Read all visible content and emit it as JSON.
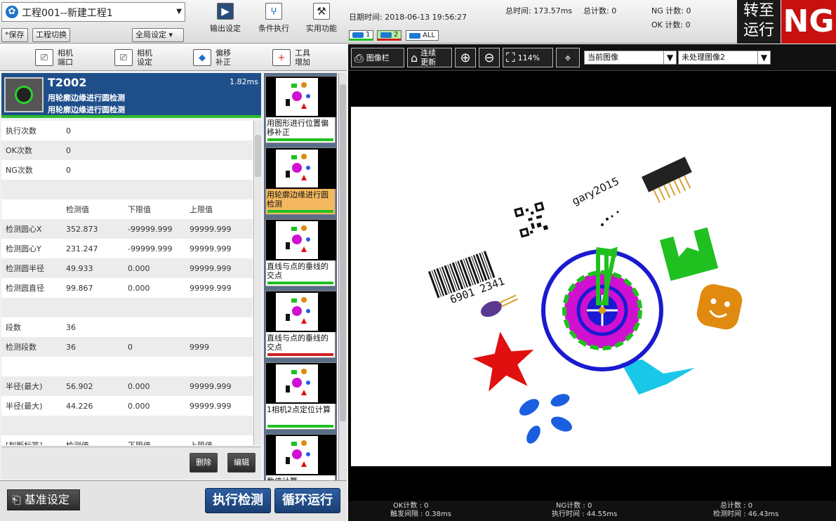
{
  "topbar": {
    "project_name": "工程001--新建工程1",
    "save_label": "*保存",
    "switch_project_label": "工程切换",
    "global_settings_label": "全局设定",
    "output_settings_label": "输出设定",
    "conditional_exec_label": "条件执行",
    "utility_label": "实用功能",
    "datetime": "日期时间: 2018-06-13 19:56:27",
    "total_time": "总时间: 173.57ms",
    "total_count": "总计数: 0",
    "ng_count": "NG 计数: 0",
    "ok_count": "OK 计数: 0",
    "run_switch_line1": "转至",
    "run_switch_line2": "运行",
    "result": "NG",
    "cam_chips": [
      "1",
      "2",
      "ALL"
    ]
  },
  "left_toolbar": [
    {
      "line1": "相机",
      "line2": "端口",
      "icon": "camera-port-icon"
    },
    {
      "line1": "相机",
      "line2": "设定",
      "icon": "camera-settings-icon"
    },
    {
      "line1": "偏移",
      "line2": "补正",
      "icon": "offset-correction-icon"
    },
    {
      "line1": "工具",
      "line2": "增加",
      "icon": "add-tool-icon"
    }
  ],
  "tool_header": {
    "id": "T2002",
    "time": "1.82ms",
    "name1": "用轮廓边缘进行圆检测",
    "name2": "用轮廓边缘进行圆检测"
  },
  "params": [
    [
      "执行次数",
      "0",
      "",
      ""
    ],
    [
      "OK次数",
      "0",
      "",
      ""
    ],
    [
      "NG次数",
      "0",
      "",
      ""
    ],
    [
      "",
      "",
      "",
      ""
    ],
    [
      "",
      "检测值",
      "下限值",
      "上限值"
    ],
    [
      "检测圆心X",
      "352.873",
      "-99999.999",
      "99999.999"
    ],
    [
      "检测圆心Y",
      "231.247",
      "-99999.999",
      "99999.999"
    ],
    [
      "检测圆半径",
      "49.933",
      "0.000",
      "99999.999"
    ],
    [
      "检测圆直径",
      "99.867",
      "0.000",
      "99999.999"
    ],
    [
      "",
      "",
      "",
      ""
    ],
    [
      "段数",
      "36",
      "",
      ""
    ],
    [
      "检测段数",
      "36",
      "0",
      "9999"
    ],
    [
      "",
      "",
      "",
      ""
    ],
    [
      "半径(最大)",
      "56.902",
      "0.000",
      "99999.999"
    ],
    [
      "半径(最大)",
      "44.226",
      "0.000",
      "99999.999"
    ],
    [
      "",
      "",
      "",
      ""
    ],
    [
      "[判断标签]",
      "检测值",
      "下限值",
      "上限值"
    ]
  ],
  "actions": {
    "delete_label": "删除",
    "edit_label": "编辑"
  },
  "tool_list": [
    {
      "label": "用图形进行位置偏移补正",
      "status_color": "#22c022",
      "selected": false
    },
    {
      "label": "用轮廓边缘进行圆检测",
      "status_color": "#22c022",
      "selected": true
    },
    {
      "label": "直线与点的垂线的交点",
      "status_color": "#22c022",
      "selected": false
    },
    {
      "label": "直线与点的垂线的交点",
      "status_color": "#d02020",
      "selected": false
    },
    {
      "label": "1相机2点定位计算",
      "status_color": "#22c022",
      "selected": false
    },
    {
      "label": "数值计算",
      "status_color": "#22c022",
      "selected": false
    }
  ],
  "bottom_left": {
    "base_settings_label": "基准设定",
    "exec_detect_label": "执行检测",
    "loop_run_label": "循环运行"
  },
  "right_toolbar": {
    "image_bar_label": "图像栏",
    "continuous_update_line1": "连续",
    "continuous_update_line2": "更新",
    "zoom": "114%",
    "current_image": "当前图像",
    "unprocessed_image": "未处理图像2"
  },
  "canvas_text": {
    "watermark": "gary2015",
    "barcode_digits": "6901 2341"
  },
  "status": {
    "ok_count": "OK计数 : 0",
    "trigger_interval": "触发间隔 : 0.38ms",
    "ng_count": "NG计数 : 0",
    "exec_time": "执行时间 : 44.55ms",
    "total_count": "总计数 : 0",
    "detect_time": "检测时间 : 46.43ms"
  }
}
